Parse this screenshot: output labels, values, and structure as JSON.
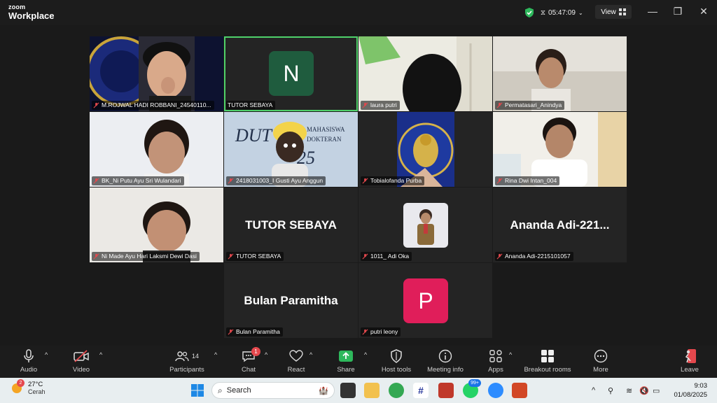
{
  "app": {
    "brand_small": "zoom",
    "brand_big": "Workplace"
  },
  "titlebar": {
    "timer": "05:47:09",
    "view_label": "View"
  },
  "tiles": [
    {
      "name": "M.ROJWAL HADI ROBBANI_24540110..."
    },
    {
      "name": "TUTOR SEBAYA",
      "initial": "N"
    },
    {
      "name": "laura putri"
    },
    {
      "name": "Permatasari_Anindya"
    },
    {
      "name": "BK_Ni Putu Ayu Sri Wulandari"
    },
    {
      "name": "2418031003_I Gusti Ayu Anggun",
      "bg_text1": "DUT",
      "bg_text2": "MAHASISWA",
      "bg_text3": "DOKTERAN",
      "bg_text4": "25"
    },
    {
      "name": "Tobialofanda Purba"
    },
    {
      "name": "Rina Dwi Intan_004"
    },
    {
      "name": "Ni Made Ayu Hari Laksmi Dewi Dasi"
    },
    {
      "name": "TUTOR SEBAYA",
      "display": "TUTOR SEBAYA"
    },
    {
      "name": "1011_ Adi Oka"
    },
    {
      "name": "Ananda Adi-2215101057",
      "display": "Ananda  Adi-221..."
    },
    {
      "name": "Bulan Paramitha",
      "display": "Bulan Paramitha"
    },
    {
      "name": "putri leony",
      "initial": "P"
    }
  ],
  "toolbar": {
    "audio": "Audio",
    "video": "Video",
    "participants": "Participants",
    "participants_count": "14",
    "chat": "Chat",
    "chat_badge": "1",
    "react": "React",
    "share": "Share",
    "host_tools": "Host tools",
    "meeting_info": "Meeting info",
    "apps": "Apps",
    "breakout": "Breakout rooms",
    "more": "More",
    "leave": "Leave"
  },
  "taskbar": {
    "weather_badge": "2",
    "temp": "27°C",
    "condition": "Cerah",
    "search": "Search",
    "notif_badge": "99+",
    "time": "9:03",
    "date": "01/08/2025"
  },
  "colors": {
    "active_border": "#4fd16a",
    "avatar_green": "#1f5c3e",
    "avatar_pink": "#e01e5a",
    "share_green": "#2eb85c",
    "badge_red": "#e5484d"
  }
}
